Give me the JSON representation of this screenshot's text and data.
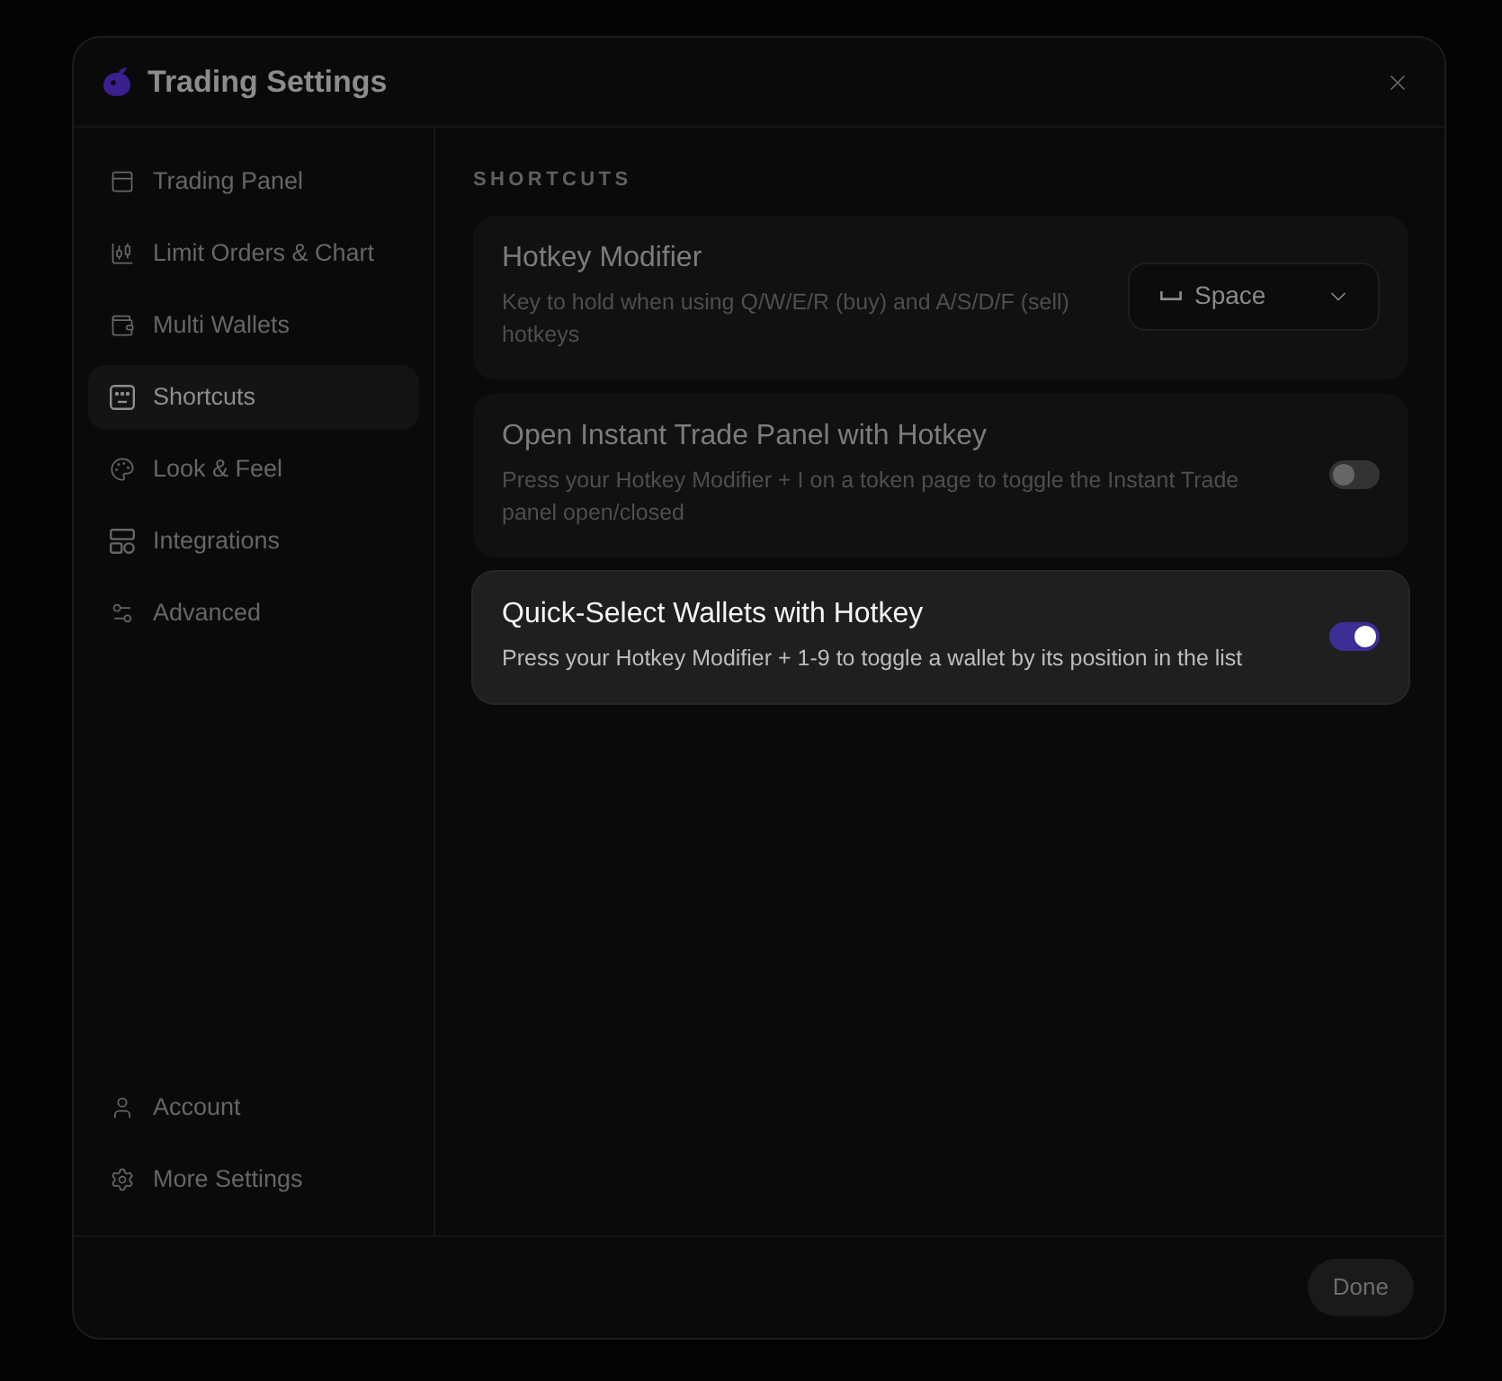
{
  "dialog": {
    "title": "Trading Settings"
  },
  "sidebar": {
    "items": [
      {
        "label": "Trading Panel",
        "selected": false
      },
      {
        "label": "Limit Orders & Chart",
        "selected": false
      },
      {
        "label": "Multi Wallets",
        "selected": false
      },
      {
        "label": "Shortcuts",
        "selected": true
      },
      {
        "label": "Look & Feel",
        "selected": false
      },
      {
        "label": "Integrations",
        "selected": false
      },
      {
        "label": "Advanced",
        "selected": false
      }
    ],
    "footer_items": [
      {
        "label": "Account",
        "selected": false
      },
      {
        "label": "More Settings",
        "selected": false
      }
    ]
  },
  "section_title": "SHORTCUTS",
  "settings": [
    {
      "kind": "select",
      "title": "Hotkey Modifier",
      "description": "Key to hold when using Q/W/E/R (buy) and A/S/D/F (sell) hotkeys",
      "value": "Space",
      "highlighted": false
    },
    {
      "kind": "toggle",
      "title": "Open Instant Trade Panel with Hotkey",
      "description": "Press your Hotkey Modifier + I on a token page to toggle the Instant Trade panel open/closed",
      "on": false,
      "highlighted": false
    },
    {
      "kind": "toggle",
      "title": "Quick-Select Wallets with Hotkey",
      "description": "Press your Hotkey Modifier + 1-9 to toggle a wallet by its position in the list",
      "on": true,
      "highlighted": true
    }
  ],
  "footer": {
    "done_button": "Done"
  }
}
